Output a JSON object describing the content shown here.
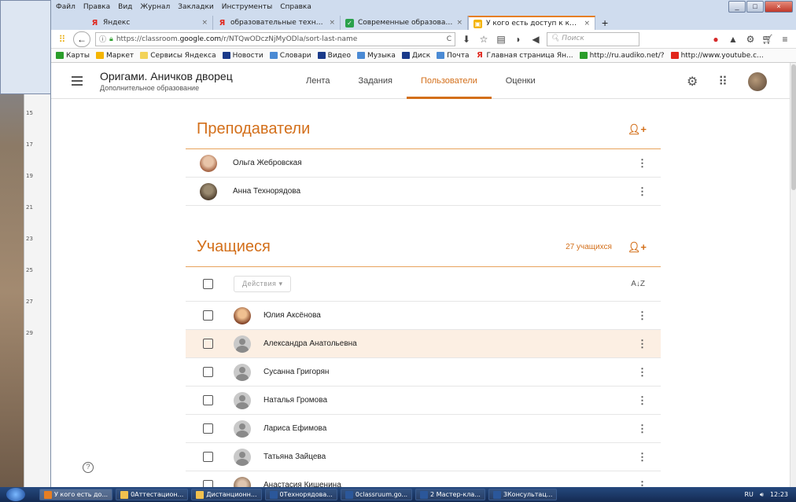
{
  "browser": {
    "menu": [
      "Файл",
      "Правка",
      "Вид",
      "Журнал",
      "Закладки",
      "Инструменты",
      "Справка"
    ],
    "tabs": [
      {
        "title": "Яндекс",
        "icon": "yandex-icon"
      },
      {
        "title": "образовательные технолог",
        "icon": "yandex-icon"
      },
      {
        "title": "Современные образовател",
        "icon": "check-icon"
      },
      {
        "title": "У кого есть доступ к курсу",
        "icon": "classroom-icon",
        "active": true
      }
    ],
    "url_prefix": "https://classroom.",
    "url_host": "google.com",
    "url_path": "/r/NTQwODczNjMyODla/sort-last-name",
    "search_placeholder": "Поиск",
    "bookmarks": [
      "Карты",
      "Маркет",
      "Сервисы Яндекса",
      "Новости",
      "Словари",
      "Видео",
      "Музыка",
      "Диск",
      "Почта",
      "Главная страница Ян...",
      "http://ru.audiko.net/?",
      "http://www.youtube.c..."
    ]
  },
  "classroom": {
    "course_title": "Оригами. Аничков дворец",
    "course_subtitle": "Дополнительное образование",
    "tabs": [
      "Лента",
      "Задания",
      "Пользователи",
      "Оценки"
    ],
    "active_tab": "Пользователи",
    "teachers": {
      "title": "Преподаватели",
      "items": [
        "Ольга Жебровская",
        "Анна Технорядова"
      ]
    },
    "students": {
      "title": "Учащиеся",
      "count": "27 учащихся",
      "actions_label": "Действия",
      "items": [
        "Юлия Аксёнова",
        "Александра Анатольевна",
        "Сусанна Григорян",
        "Наталья Громова",
        "Лариса Ефимова",
        "Татьяна Зайцева",
        "Анастасия Кишенина"
      ]
    }
  },
  "taskbar": {
    "items": [
      "У кого есть до...",
      "0Аттестацион...",
      "Дистанционн...",
      "0Технорядова...",
      "0classruum.go...",
      "2 Мастер-кла...",
      "3Консультац..."
    ],
    "lang": "RU",
    "time": "12:23"
  },
  "colors": {
    "accent": "#d36f1a",
    "highlight_row": "#fcefe3"
  }
}
